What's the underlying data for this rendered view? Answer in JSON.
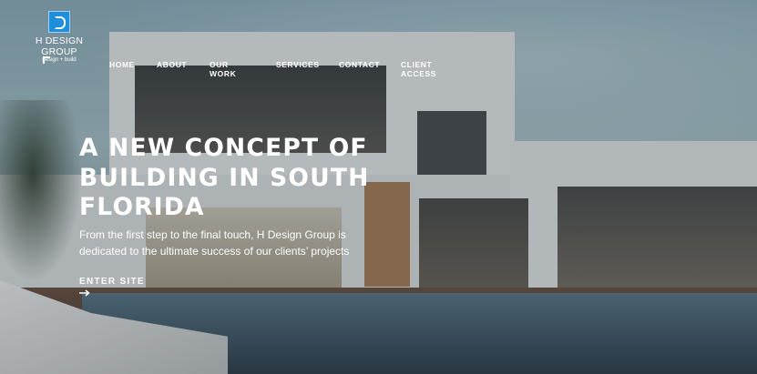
{
  "brand": {
    "name": "H DESIGN GROUP",
    "tagline": "design + build",
    "accent": "#1f8fdc"
  },
  "nav": {
    "items": [
      {
        "label": "HOME"
      },
      {
        "label": "ABOUT"
      },
      {
        "label": "OUR WORK"
      },
      {
        "label": "SERVICES"
      },
      {
        "label": "CONTACT"
      },
      {
        "label": "CLIENT ACCESS"
      }
    ]
  },
  "hero": {
    "headline": "A NEW CONCEPT OF BUILDING IN SOUTH FLORIDA",
    "subtext": "From the first step to the final touch, H Design Group is dedicated to the ultimate success of our clients’ projects",
    "cta_label": "ENTER SITE",
    "cta_icon": "arrow-right-icon"
  }
}
